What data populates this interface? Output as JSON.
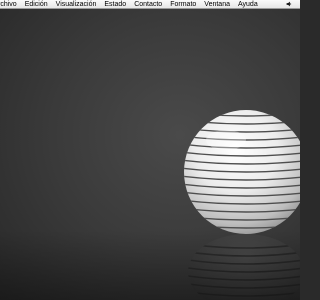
{
  "menubar": {
    "items": [
      {
        "label": "rchivo"
      },
      {
        "label": "Edición"
      },
      {
        "label": "Visualización"
      },
      {
        "label": "Estado"
      },
      {
        "label": "Contacto"
      },
      {
        "label": "Formato"
      },
      {
        "label": "Ventana"
      },
      {
        "label": "Ayuda"
      }
    ],
    "status_icon": "speaker-icon"
  },
  "desktop": {
    "wallpaper": "striped-sphere-reflection",
    "colors": {
      "background_dark": "#202020",
      "background_light": "#4a4a4a",
      "sphere_light": "#f5f5f5",
      "sphere_shadow": "#6a6a6a"
    }
  }
}
